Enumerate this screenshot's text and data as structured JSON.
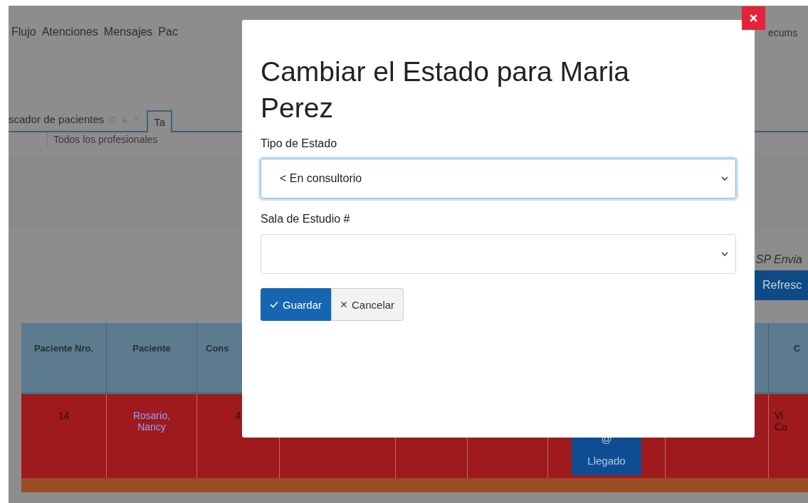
{
  "menu": [
    "Flujo",
    "Atenciones",
    "Mensajes",
    "Pac"
  ],
  "menu_right": "ecums",
  "tabs": [
    {
      "label": "scador de pacientes",
      "selected": false,
      "tools": true
    },
    {
      "label": "Ta",
      "selected": true,
      "tools": false
    }
  ],
  "filter": "Todos los profesionales",
  "notice": "SP Envia",
  "refresh_button": "Refresc",
  "table": {
    "columns": [
      {
        "label": "Paciente Nro."
      },
      {
        "label": "Paciente"
      },
      {
        "label": "Cons"
      },
      {},
      {},
      {},
      {},
      {},
      {
        "label": "C"
      }
    ],
    "rows": [
      {
        "number": "14",
        "patient": "Rosario, Nancy",
        "column_3": "4",
        "status_button": {
          "icon": "@",
          "label": "Llegado"
        },
        "column_9": [
          "Vi",
          "Co"
        ]
      }
    ]
  },
  "modal": {
    "title": "Cambiar el Estado para Maria Perez",
    "fields": [
      {
        "label": "Tipo de Estado",
        "kind": "select",
        "value": "< En consultorio",
        "focused": true
      },
      {
        "label": "Sala de Estudio #",
        "kind": "select",
        "focused": false
      }
    ],
    "buttons": [
      {
        "label": "Guardar",
        "kind": "primary"
      },
      {
        "label": "Cancelar",
        "kind": "secondary"
      }
    ]
  }
}
